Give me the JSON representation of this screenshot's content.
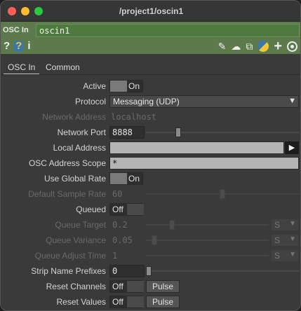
{
  "window": {
    "title": "/project1/oscin1"
  },
  "operator": {
    "type_label": "OSC In",
    "name": "oscin1",
    "left_icons": [
      "help-icon",
      "python-help-icon",
      "info-icon"
    ],
    "right_icons": [
      "edit-icon",
      "comment-icon",
      "clone-icon",
      "python-icon",
      "add-icon",
      "viewer-icon"
    ],
    "left_glyphs": {
      "help": "?",
      "python_help": "?",
      "info": "i"
    },
    "right_glyphs": {
      "edit": "✎",
      "comment": "☁",
      "clone": "⧉",
      "add": "+"
    }
  },
  "tabs": [
    {
      "label": "OSC In",
      "active": true
    },
    {
      "label": "Common",
      "active": false
    }
  ],
  "params": {
    "active": {
      "label": "Active",
      "value": "On"
    },
    "protocol": {
      "label": "Protocol",
      "value": "Messaging (UDP)",
      "caret": "▼"
    },
    "network_address": {
      "label": "Network Address",
      "value": "localhost"
    },
    "network_port": {
      "label": "Network Port",
      "value": "8888",
      "slider_fraction": 0.2
    },
    "local_address": {
      "label": "Local Address",
      "value": "",
      "button": "▶"
    },
    "osc_address_scope": {
      "label": "OSC Address Scope",
      "value": "*"
    },
    "use_global_rate": {
      "label": "Use Global Rate",
      "value": "On"
    },
    "default_sample_rate": {
      "label": "Default Sample Rate",
      "value": "60",
      "slider_fraction": 0.5
    },
    "queued": {
      "label": "Queued",
      "value": "Off"
    },
    "queue_target": {
      "label": "Queue Target",
      "value": "0.2",
      "slider_fraction": 0.2,
      "unit": "S",
      "caret": "▼"
    },
    "queue_variance": {
      "label": "Queue Variance",
      "value": "0.05",
      "slider_fraction": 0.05,
      "unit": "S",
      "caret": "▼"
    },
    "queue_adjust_time": {
      "label": "Queue Adjust Time",
      "value": "1",
      "slider_fraction": 0.0,
      "unit": "S",
      "caret": "▼"
    },
    "strip_name_prefixes": {
      "label": "Strip Name Prefixes",
      "value": "0",
      "slider_fraction": 0.0
    },
    "reset_channels": {
      "label": "Reset Channels",
      "value": "Off",
      "pulse": "Pulse"
    },
    "reset_values": {
      "label": "Reset Values",
      "value": "Off",
      "pulse": "Pulse"
    }
  }
}
